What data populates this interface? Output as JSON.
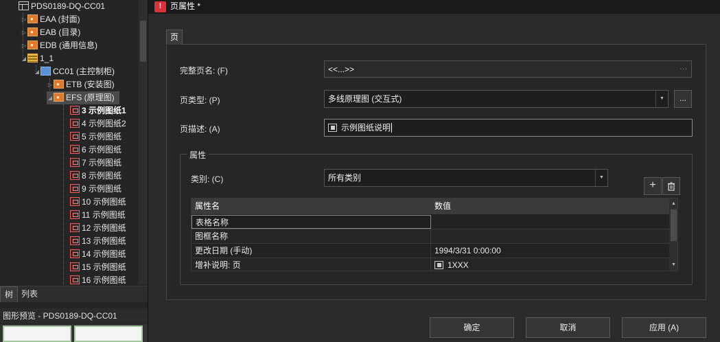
{
  "tree": {
    "root": "PDS0189-DQ-CC01",
    "items": [
      {
        "label": "EAA (封面)"
      },
      {
        "label": "EAB (目录)"
      },
      {
        "label": "EDB (通用信息)"
      },
      {
        "label": "1_1"
      },
      {
        "label": "CC01 (主控制柜)"
      },
      {
        "label": "ETB (安装图)"
      },
      {
        "label": "EFS (原理图)"
      }
    ],
    "pages": [
      "3 示例图纸1",
      "4 示例图纸2",
      "5 示例图纸",
      "6 示例图纸",
      "7 示例图纸",
      "8 示例图纸",
      "9 示例图纸",
      "10 示例图纸",
      "11 示例图纸",
      "12 示例图纸",
      "13 示例图纸",
      "14 示例图纸",
      "15 示例图纸",
      "16 示例图纸"
    ]
  },
  "left_tabs": [
    "树",
    "列表"
  ],
  "preview": {
    "title": "图形预览 - PDS0189-DQ-CC01"
  },
  "dialog": {
    "title": "页属性 *",
    "tab": "页",
    "full_name": {
      "label": "完整页名: (F)",
      "value": "<<...>>",
      "dots": "..."
    },
    "page_type": {
      "label": "页类型: (P)",
      "value": "多线原理图 (交互式)",
      "more": "..."
    },
    "description": {
      "label": "页描述: (A)",
      "value": "示例图纸说明"
    },
    "properties_group": "属性",
    "category": {
      "label": "类别: (C)",
      "value": "所有类别"
    },
    "add_symbol": "+",
    "grid": {
      "headers": [
        "属性名",
        "数值"
      ],
      "rows": [
        {
          "name": "表格名称",
          "value": ""
        },
        {
          "name": "图框名称",
          "value": ""
        },
        {
          "name": "更改日期 (手动)",
          "value": "1994/3/31 0:00:00"
        },
        {
          "name": "增补说明: 页",
          "value": "1XXX"
        }
      ]
    },
    "buttons": {
      "ok": "确定",
      "cancel": "取消",
      "apply": "应用 (A)"
    }
  },
  "colors": {
    "accent_warn": "#d8343a",
    "page_icon": "#ff5a5a",
    "folder_orange": "#e07a2a",
    "panel_bg": "#262626"
  }
}
